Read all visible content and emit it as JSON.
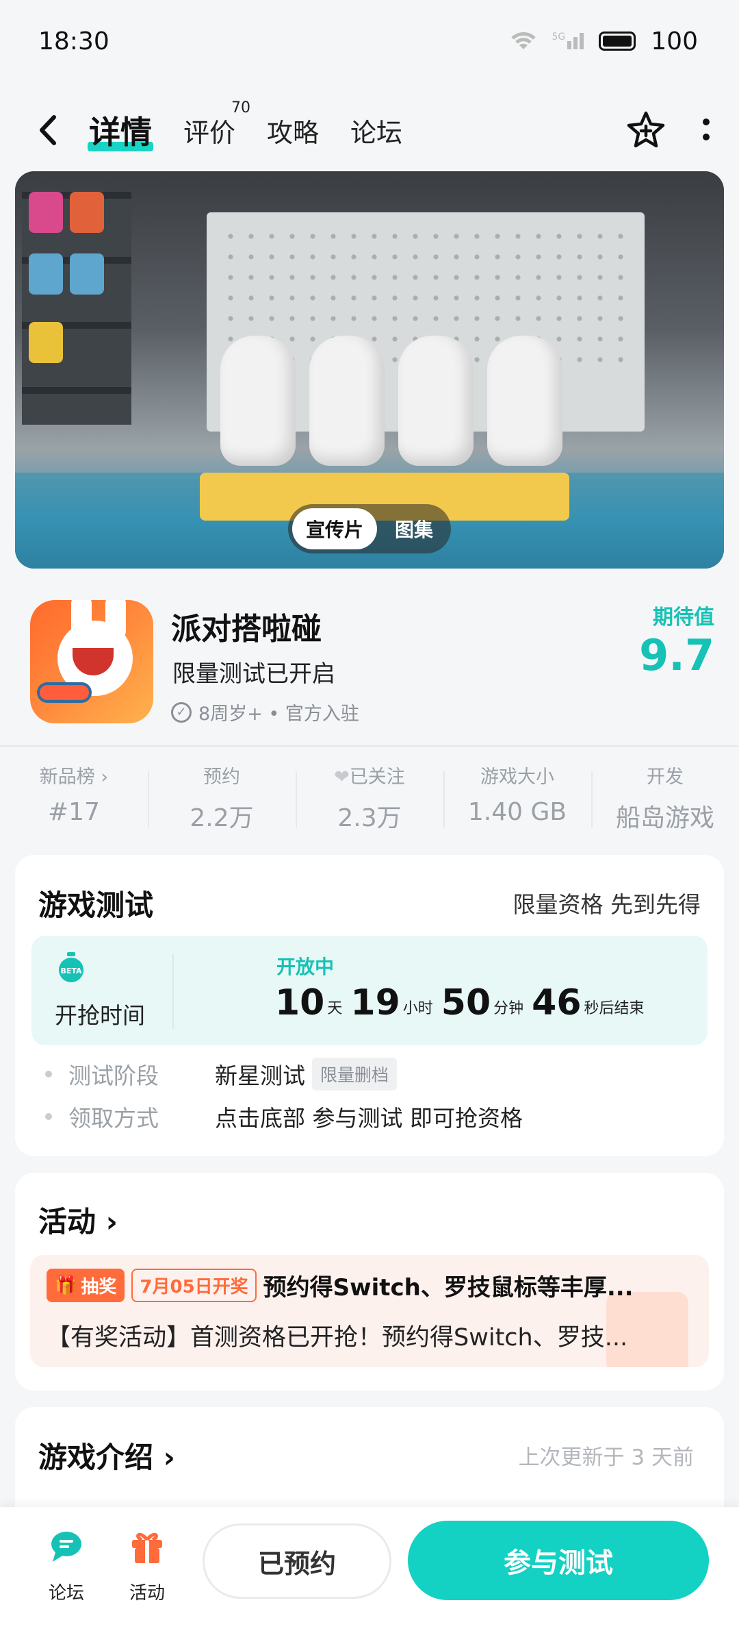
{
  "status": {
    "time": "18:30",
    "signal": "5G",
    "battery": "100"
  },
  "nav": {
    "tabs": [
      {
        "label": "详情"
      },
      {
        "label": "评价",
        "badge": "70"
      },
      {
        "label": "攻略"
      },
      {
        "label": "论坛"
      }
    ]
  },
  "banner": {
    "tab_video": "宣传片",
    "tab_gallery": "图集"
  },
  "game": {
    "name": "派对搭啦碰",
    "tagline": "限量测试已开启",
    "meta": "8周岁+ • 官方入驻",
    "expect_label": "期待值",
    "expect_value": "9.7"
  },
  "stats": [
    {
      "label": "新品榜 ›",
      "value": "#17"
    },
    {
      "label": "预约",
      "value": "2.2万"
    },
    {
      "label": "已关注",
      "value": "2.3万"
    },
    {
      "label": "游戏大小",
      "value": "1.40 GB"
    },
    {
      "label": "开发",
      "value": "船岛游戏"
    }
  ],
  "test": {
    "title": "游戏测试",
    "note": "限量资格 先到先得",
    "timer_label": "开抢时间",
    "status": "开放中",
    "days": "10",
    "days_unit": "天",
    "hours": "19",
    "hours_unit": "小时",
    "minutes": "50",
    "minutes_unit": "分钟",
    "seconds": "46",
    "seconds_unit": "秒后结束",
    "stage_label": "测试阶段",
    "stage_value": "新星测试",
    "stage_tag": "限量删档",
    "method_label": "领取方式",
    "method_value": "点击底部 参与测试 即可抢资格"
  },
  "activity": {
    "title": "活动 ›",
    "tag": "抽奖",
    "date_tag": "7月05日开奖",
    "headline": "预约得Switch、罗技鼠标等丰厚...",
    "desc": "【有奖活动】首测资格已开抢！预约得Switch、罗技..."
  },
  "intro": {
    "title": "游戏介绍 ›",
    "updated": "上次更新于 3 天前"
  },
  "bottom": {
    "forum": "论坛",
    "activity": "活动",
    "reserved": "已预约",
    "join": "参与测试"
  },
  "colors": {
    "accent": "#13d1c3",
    "orange": "#ff6b3a"
  }
}
